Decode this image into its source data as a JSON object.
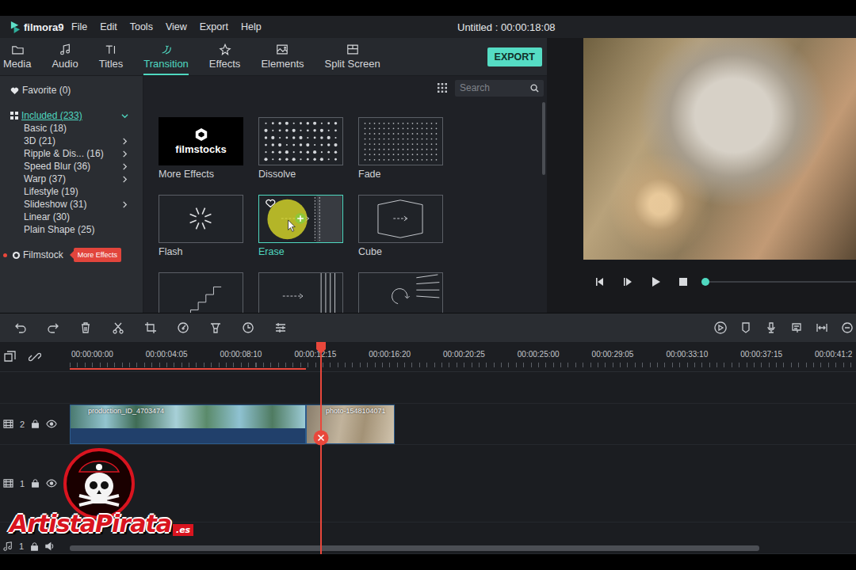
{
  "app": {
    "logo": "filmora9",
    "title": "Untitled : 00:00:18:08"
  },
  "menu": [
    "File",
    "Edit",
    "Tools",
    "View",
    "Export",
    "Help"
  ],
  "tabs": [
    {
      "label": "Media",
      "selected": false
    },
    {
      "label": "Audio",
      "selected": false
    },
    {
      "label": "Titles",
      "selected": false
    },
    {
      "label": "Transition",
      "selected": true
    },
    {
      "label": "Effects",
      "selected": false
    },
    {
      "label": "Elements",
      "selected": false
    },
    {
      "label": "Split Screen",
      "selected": false
    }
  ],
  "export_button": "EXPORT",
  "sidebar": {
    "favorite": "Favorite (0)",
    "group": {
      "label": "Included (233)",
      "expanded": true,
      "selected": true
    },
    "items": [
      {
        "label": "Basic (18)",
        "expandable": false
      },
      {
        "label": "3D (21)",
        "expandable": true
      },
      {
        "label": "Ripple & Dis... (16)",
        "expandable": true
      },
      {
        "label": "Speed Blur (36)",
        "expandable": true
      },
      {
        "label": "Warp (37)",
        "expandable": true
      },
      {
        "label": "Lifestyle (19)",
        "expandable": false
      },
      {
        "label": "Slideshow (31)",
        "expandable": true
      },
      {
        "label": "Linear (30)",
        "expandable": false
      },
      {
        "label": "Plain Shape (25)",
        "expandable": false
      }
    ],
    "filmstock": {
      "label": "Filmstock",
      "badge": "More Effects",
      "new": true
    }
  },
  "search": {
    "placeholder": "Search"
  },
  "transitions": [
    {
      "label": "More Effects",
      "logo": "filmstocks",
      "kind": "filmstocks",
      "selected": false,
      "hovered": false
    },
    {
      "label": "Dissolve",
      "kind": "dissolve",
      "selected": false,
      "hovered": false
    },
    {
      "label": "Fade",
      "kind": "fade",
      "selected": false,
      "hovered": false
    },
    {
      "label": "Flash",
      "kind": "flash",
      "selected": false,
      "hovered": false
    },
    {
      "label": "Erase",
      "kind": "erase",
      "selected": true,
      "hovered": true
    },
    {
      "label": "Cube",
      "kind": "cube",
      "selected": false,
      "hovered": false
    },
    {
      "kind": "stairs",
      "selected": false,
      "hovered": false
    },
    {
      "kind": "slide",
      "selected": false,
      "hovered": false
    },
    {
      "kind": "spin",
      "selected": false,
      "hovered": false
    }
  ],
  "preview": {
    "level": 0
  },
  "timeline": {
    "ruler": [
      "00:00:00:00",
      "00:00:04:05",
      "00:00:08:10",
      "00:00:12:15",
      "00:00:16:20",
      "00:00:20:25",
      "00:00:25:00",
      "00:00:29:05",
      "00:00:33:10",
      "00:00:37:15",
      "00:00:41:2"
    ],
    "playhead": {
      "level": 0.32
    },
    "rendered": {
      "level": 0.3
    },
    "tracks": [
      {
        "label": "2",
        "kind": "video",
        "clips": [
          {
            "name": "production_ID_4703474"
          },
          {
            "name": "photo-1548104071"
          }
        ]
      },
      {
        "label": "1",
        "kind": "video",
        "clips": []
      },
      {
        "label": "1",
        "kind": "audio",
        "clips": []
      }
    ]
  },
  "watermark": {
    "text": "ArtistaPirata",
    "suffix": ".es"
  }
}
